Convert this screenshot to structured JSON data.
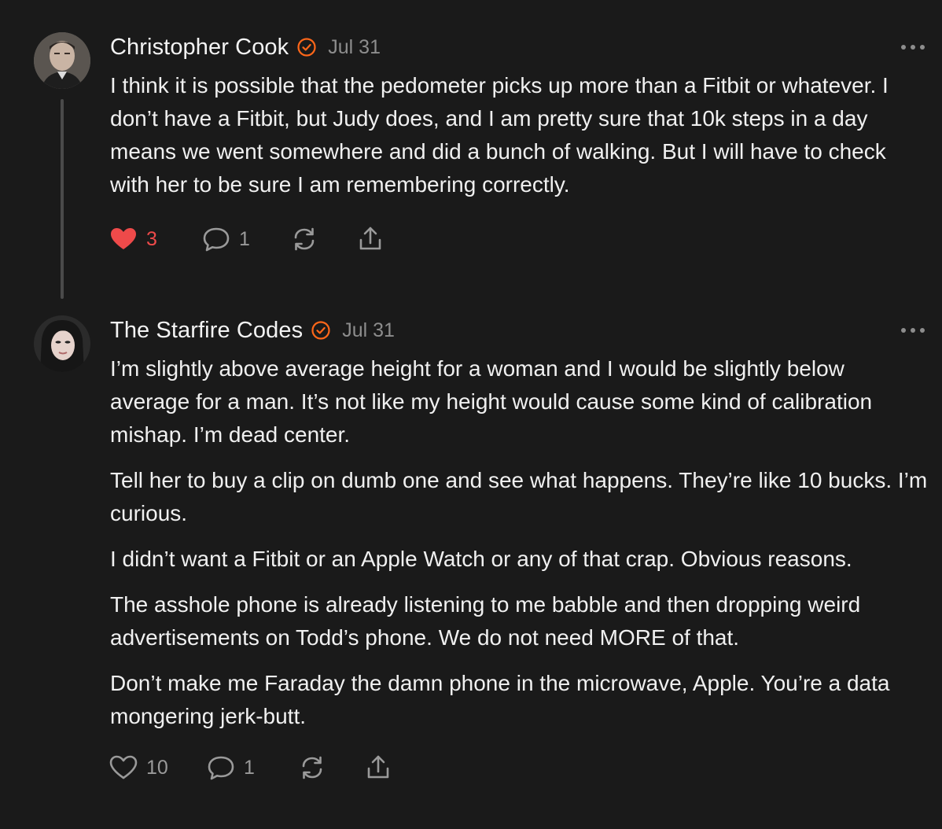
{
  "comments": [
    {
      "author": "Christopher Cook",
      "date": "Jul 31",
      "paragraphs": [
        "I think it is possible that the pedometer picks up more than a Fitbit or whatever. I don’t have a Fitbit, but Judy does, and I am pretty sure that 10k steps in a day means we went somewhere and did a bunch of walking. But I will have to check with her to be sure I am remembering correctly."
      ],
      "likes": "3",
      "liked": true,
      "replies": "1",
      "icons": [
        "avatar",
        "verified-badge-icon",
        "more-icon",
        "heart-filled-icon",
        "comment-bubble-icon",
        "restack-icon",
        "share-icon"
      ]
    },
    {
      "author": "The Starfire Codes",
      "date": "Jul 31",
      "paragraphs": [
        "I’m slightly above average height for a woman and I would be slightly below average for a man. It’s not like my height would cause some kind of calibration mishap. I’m dead center.",
        "Tell her to buy a clip on dumb one and see what happens. They’re like 10 bucks. I’m curious.",
        "I didn’t want a Fitbit or an Apple Watch or any of that crap. Obvious reasons.",
        "The asshole phone is already listening to me babble and then dropping weird advertisements on Todd’s phone. We do not need MORE of that.",
        "Don’t make me Faraday the damn phone in the microwave, Apple. You’re a data mongering jerk-butt."
      ],
      "likes": "10",
      "liked": false,
      "replies": "1",
      "icons": [
        "avatar",
        "verified-badge-icon",
        "more-icon",
        "heart-outline-icon",
        "comment-bubble-icon",
        "restack-icon",
        "share-icon"
      ]
    }
  ],
  "colors": {
    "background": "#1a1a1a",
    "accent": "#ff6719",
    "liked": "#ee4a4a",
    "muted": "#8d8d8d",
    "text": "#f0f0f0"
  }
}
